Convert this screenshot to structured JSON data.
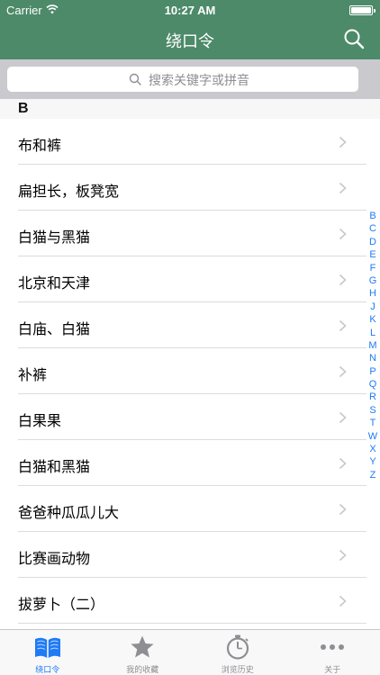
{
  "status_bar": {
    "carrier": "Carrier",
    "time": "10:27 AM"
  },
  "nav": {
    "title": "绕口令",
    "search_icon": "search-icon"
  },
  "search": {
    "placeholder": "搜索关键字或拼音"
  },
  "section": {
    "letter": "B"
  },
  "items": [
    {
      "label": "布和裤"
    },
    {
      "label": "扁担长，板凳宽"
    },
    {
      "label": "白猫与黑猫"
    },
    {
      "label": "北京和天津"
    },
    {
      "label": "白庙、白猫"
    },
    {
      "label": "补裤"
    },
    {
      "label": "白果果"
    },
    {
      "label": "白猫和黑猫"
    },
    {
      "label": "爸爸种瓜瓜儿大"
    },
    {
      "label": "比赛画动物"
    },
    {
      "label": "拔萝卜（二）"
    }
  ],
  "index_letters": [
    "B",
    "C",
    "D",
    "E",
    "F",
    "G",
    "H",
    "J",
    "K",
    "L",
    "M",
    "N",
    "P",
    "Q",
    "R",
    "S",
    "T",
    "W",
    "X",
    "Y",
    "Z"
  ],
  "tabs": [
    {
      "label": "绕口令",
      "icon": "book-icon",
      "active": true
    },
    {
      "label": "我的收藏",
      "icon": "star-icon",
      "active": false
    },
    {
      "label": "浏览历史",
      "icon": "stopwatch-icon",
      "active": false
    },
    {
      "label": "关于",
      "icon": "more-icon",
      "active": false
    }
  ],
  "colors": {
    "nav_bar": "#4c8a69",
    "accent": "#1e7bf5",
    "search_bg": "#c9c9ce"
  }
}
